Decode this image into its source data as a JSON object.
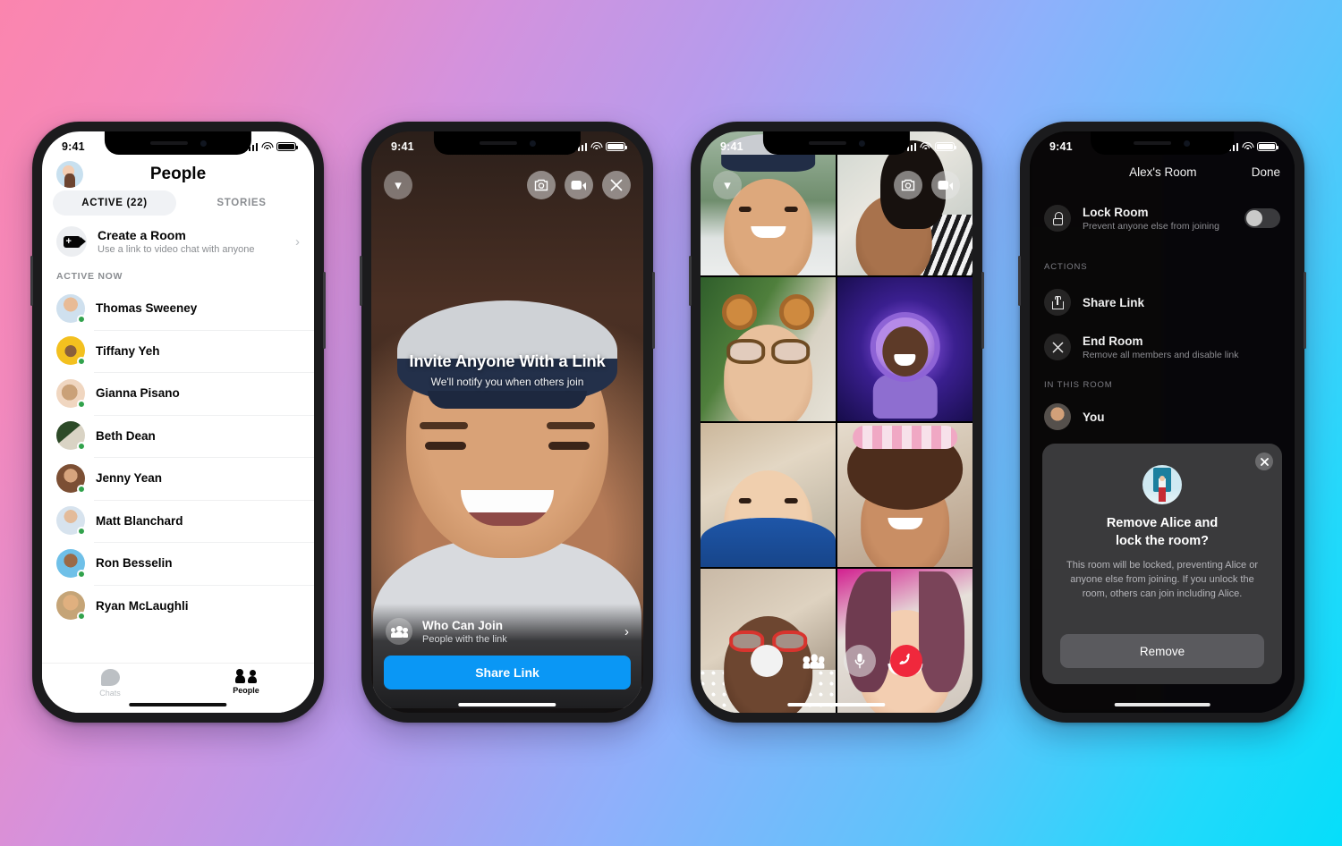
{
  "background": {
    "gradient_from": "#FB85AE",
    "gradient_mid": "#B79BEC",
    "gradient_to": "#05DEFA"
  },
  "phone1": {
    "status": {
      "time": "9:41"
    },
    "header": {
      "title": "People",
      "avatar_icon": "user-avatar"
    },
    "tabs": [
      {
        "label": "ACTIVE (22)",
        "active": true
      },
      {
        "label": "STORIES",
        "active": false
      }
    ],
    "create_room": {
      "title": "Create a Room",
      "subtitle": "Use a link to video chat with anyone",
      "icon": "video-plus-icon",
      "chevron": "›"
    },
    "section_label": "ACTIVE NOW",
    "people": [
      {
        "name": "Thomas Sweeney"
      },
      {
        "name": "Tiffany Yeh"
      },
      {
        "name": "Gianna Pisano"
      },
      {
        "name": "Beth Dean"
      },
      {
        "name": "Jenny Yean"
      },
      {
        "name": "Matt Blanchard"
      },
      {
        "name": "Ron Besselin"
      },
      {
        "name": "Ryan McLaughli"
      }
    ],
    "nav": [
      {
        "label": "Chats",
        "icon": "chat-bubble-icon",
        "active": false
      },
      {
        "label": "People",
        "icon": "people-icon",
        "active": true
      }
    ],
    "online_color": "#31A24C"
  },
  "phone2": {
    "status": {
      "time": "9:41"
    },
    "top_controls": [
      {
        "icon": "flip-camera-icon"
      },
      {
        "icon": "video-camera-icon"
      },
      {
        "icon": "close-icon"
      }
    ],
    "collapse_icon": "chevron-down-icon",
    "headline": "Invite Anyone With a Link",
    "subheadline": "We'll notify you when others join",
    "who_can_join": {
      "title": "Who Can Join",
      "subtitle": "People with the link",
      "icon": "group-icon",
      "chevron": "›"
    },
    "share_button": {
      "label": "Share Link",
      "color": "#0A97F5"
    }
  },
  "phone3": {
    "status": {
      "time": "9:41"
    },
    "collapse_icon": "chevron-down-icon",
    "top_controls": [
      {
        "icon": "flip-camera-icon"
      },
      {
        "icon": "video-camera-icon"
      }
    ],
    "participant_count": 8,
    "bottom_controls": [
      {
        "icon": "effects-icon",
        "style": "white"
      },
      {
        "icon": "add-people-icon",
        "style": "ghost"
      },
      {
        "icon": "microphone-icon",
        "style": "grey"
      },
      {
        "icon": "end-call-icon",
        "style": "red"
      }
    ],
    "end_call_color": "#F0283C"
  },
  "phone4": {
    "status": {
      "time": "9:41"
    },
    "title": "Alex's Room",
    "done_label": "Done",
    "lock_room": {
      "title": "Lock Room",
      "subtitle": "Prevent anyone else from joining",
      "icon": "lock-icon",
      "toggle_on": false
    },
    "actions_label": "ACTIONS",
    "actions": [
      {
        "title": "Share Link",
        "subtitle": "",
        "icon": "share-icon"
      },
      {
        "title": "End Room",
        "subtitle": "Remove all members and disable link",
        "icon": "close-circle-icon"
      }
    ],
    "in_this_room_label": "IN THIS ROOM",
    "members": [
      {
        "name": "You"
      }
    ],
    "modal": {
      "close_icon": "close-icon",
      "illustration": "person-at-door-illustration",
      "title_line1": "Remove Alice and",
      "title_line2": "lock the room?",
      "body": "This room will be locked, preventing Alice or anyone else from joining. If you unlock the room, others can join including Alice.",
      "button_label": "Remove"
    }
  }
}
